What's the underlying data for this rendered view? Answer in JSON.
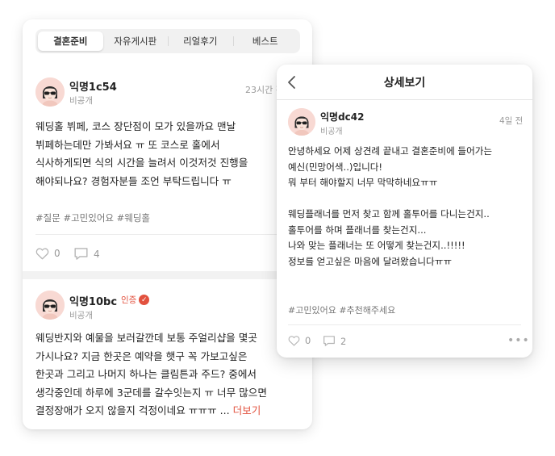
{
  "feed": {
    "tabs": [
      {
        "label": "결혼준비",
        "active": true
      },
      {
        "label": "자유게시판",
        "active": false
      },
      {
        "label": "리얼후기",
        "active": false
      },
      {
        "label": "베스트",
        "active": false
      }
    ],
    "posts": [
      {
        "username": "익명1c54",
        "visibility": "비공개",
        "time": "23시간 전",
        "body": "웨딩홀 뷔페, 코스 장단점이 모가 있을까요 맨날\n뷔페하는데만 가봐서요 ㅠ 또 코스로 홀에서\n식사하게되면 식의 시간을 늘려서 이것저것 진행을\n해야되나요? 경험자분들 조언 부탁드립니다 ㅠ",
        "tags": "#질문 #고민있어요 #웨딩홀",
        "likes": "0",
        "comments": "4"
      },
      {
        "username": "익명10bc",
        "verified_label": "인증",
        "visibility": "비공개",
        "body": "웨딩반지와 예물을 보러갈깐데 보통 주얼리샵을 몇곳\n가시나요? 지금 한곳은 예약을 햇구 꼭 가보고싶은\n한곳과 그리고 나머지 하나는 클림튼과 주드? 중에서\n생각중인데 하루에 3군데를 갈수잇는지 ㅠ 너무 많으면\n결정장애가 오지 않을지 걱정이네요 ㅠㅠㅠ ...",
        "more_label": "더보기"
      }
    ]
  },
  "detail": {
    "title": "상세보기",
    "username": "익명dc42",
    "visibility": "비공개",
    "time": "4일 전",
    "body": "안녕하세요 어제 상견례 끝내고 결혼준비에 들어가는\n예신(민망어색..)입니다!\n뭐 부터 해야할지 너무 막막하네요ㅠㅠ\n\n웨딩플래너를 먼저 찾고 함께 홀투어를 다니는건지..\n홀투어를 하며 플래너를 찾는건지...\n나와 맞는 플래너는 또 어떻게 찾는건지..!!!!!\n정보를 얻고싶은 마음에 달려왔습니다ㅠㅠ",
    "tags": "#고민있어요 #추천해주세요",
    "likes": "0",
    "comments": "2",
    "more_icon": "•••"
  },
  "colors": {
    "accent": "#e2513e",
    "avatar_bg": "#f8d9d3",
    "muted_text": "#9b9b9b"
  },
  "icons": [
    "chevron-left-icon",
    "heart-icon",
    "comment-icon",
    "verified-check-icon",
    "more-dots-icon",
    "avatar-sunglasses-icon"
  ]
}
